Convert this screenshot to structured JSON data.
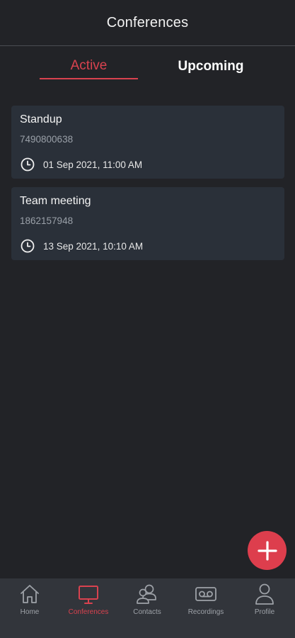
{
  "header": {
    "title": "Conferences"
  },
  "tabs": [
    {
      "label": "Active",
      "selected": true
    },
    {
      "label": "Upcoming",
      "selected": false
    }
  ],
  "conferences": [
    {
      "title": "Standup",
      "number": "7490800638",
      "datetime": "01 Sep 2021, 11:00 AM",
      "icon": "clock-icon"
    },
    {
      "title": "Team meeting",
      "number": "1862157948",
      "datetime": "13 Sep 2021, 10:10 AM",
      "icon": "clock-icon"
    }
  ],
  "fab": {
    "icon": "plus-icon",
    "color": "#dd3e4d"
  },
  "bottom_nav": [
    {
      "label": "Home",
      "icon": "home-icon",
      "active": false
    },
    {
      "label": "Conferences",
      "icon": "monitor-icon",
      "active": true
    },
    {
      "label": "Contacts",
      "icon": "contacts-icon",
      "active": false
    },
    {
      "label": "Recordings",
      "icon": "voicemail-icon",
      "active": false
    },
    {
      "label": "Profile",
      "icon": "profile-icon",
      "active": false
    }
  ],
  "colors": {
    "background": "#222327",
    "card": "#2a3039",
    "accent": "#d9424f",
    "nav_background": "#32353b",
    "muted_text": "#9aa0a8"
  }
}
